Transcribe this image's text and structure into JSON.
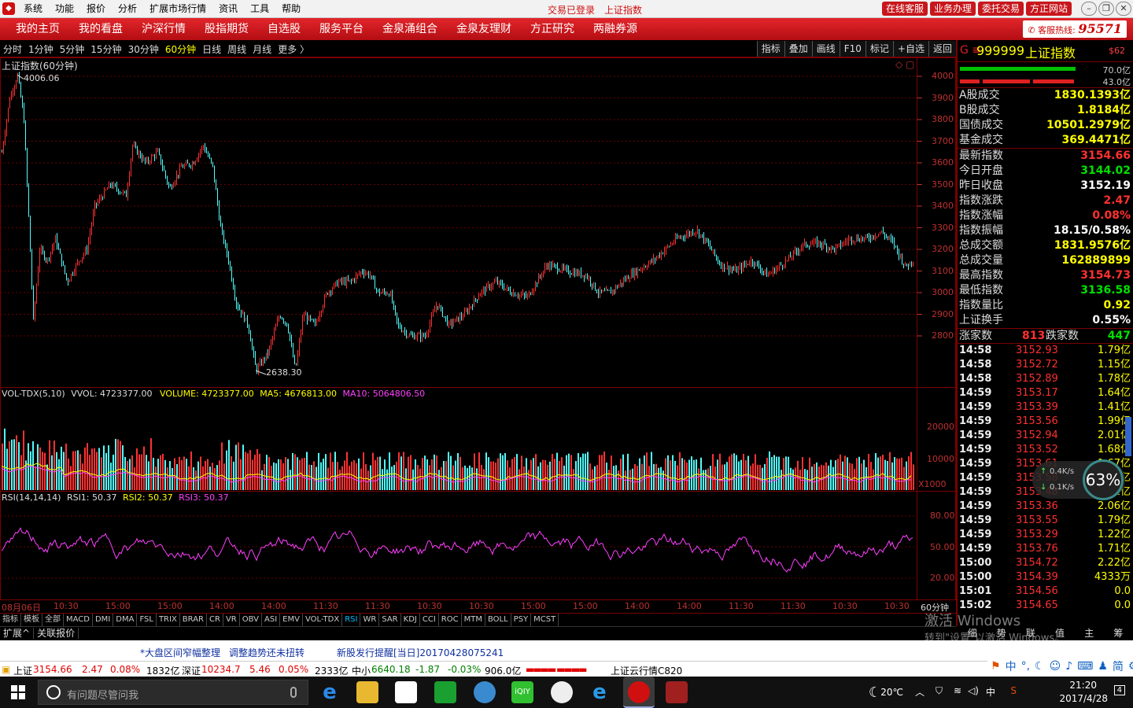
{
  "menubar": {
    "items": [
      "系统",
      "功能",
      "报价",
      "分析",
      "扩展市场行情",
      "资讯",
      "工具",
      "帮助"
    ],
    "trade_status": "交易已登录",
    "current_name": "上证指数",
    "buttons": [
      "在线客服",
      "业务办理",
      "委托交易",
      "方正网站"
    ]
  },
  "navbar": {
    "items": [
      "我的主页",
      "我的看盘",
      "沪深行情",
      "股指期货",
      "自选股",
      "服务平台",
      "金泉涌组合",
      "金泉友理财",
      "方正研究",
      "两融券源"
    ],
    "hotline_label": "客服热线:",
    "hotline_number": "95571"
  },
  "periodbar": {
    "periods": [
      "分时",
      "1分钟",
      "5分钟",
      "15分钟",
      "30分钟",
      "60分钟",
      "日线",
      "周线",
      "月线",
      "更多 〉"
    ],
    "active_index": 5,
    "tools": [
      "指标",
      "叠加",
      "画线",
      "F10",
      "标记",
      "+自选",
      "返回"
    ]
  },
  "main_chart": {
    "title": "上证指数(60分钟)",
    "high_label": "4006.06",
    "low_label": "2638.30",
    "y_ticks": [
      "4000",
      "3900",
      "3800",
      "3700",
      "3600",
      "3500",
      "3400",
      "3300",
      "3200",
      "3100",
      "3000",
      "2900",
      "2800"
    ]
  },
  "vol_chart": {
    "header_name": "VOL-TDX(5,10)",
    "vvol": "VVOL: 4723377.00",
    "volume": "VOLUME: 4723377.00",
    "ma5": "MA5: 4676813.00",
    "ma10": "MA10: 5064806.50",
    "y_ticks": [
      "20000",
      "10000"
    ],
    "unit": "X1000"
  },
  "rsi_chart": {
    "header_name": "RSI(14,14,14)",
    "rsi1": "RSI1: 50.37",
    "rsi2": "RSI2: 50.37",
    "rsi3": "RSI3: 50.37",
    "y_ticks": [
      "80.00",
      "50.00",
      "20.00"
    ]
  },
  "time_axis": {
    "labels": [
      "08月06日",
      "10:30",
      "15:00",
      "15:00",
      "14:00",
      "14:00",
      "11:30",
      "11:30",
      "10:30",
      "10:30",
      "15:00",
      "15:00",
      "14:00",
      "14:00",
      "11:30",
      "11:30",
      "10:30",
      "10:30"
    ],
    "period_label": "60分钟"
  },
  "indicator_tabs": [
    "指标",
    "模板",
    "全部",
    "MACD",
    "DMI",
    "DMA",
    "FSL",
    "TRIX",
    "BRAR",
    "CR",
    "VR",
    "OBV",
    "ASI",
    "EMV",
    "VOL-TDX",
    "RSI",
    "WR",
    "SAR",
    "KDJ",
    "CCI",
    "ROC",
    "MTM",
    "BOLL",
    "PSY",
    "MCST"
  ],
  "indicator_active": "RSI",
  "bottom_tabs": [
    "扩展^",
    "关联报价"
  ],
  "right_panel": {
    "marker": "G ≡",
    "code": "999999",
    "name": "上证指数",
    "tag": "$62",
    "bar_values": [
      "70.0亿",
      "43.0亿"
    ],
    "turnover": [
      {
        "label": "A股成交",
        "value": "1830.1393亿"
      },
      {
        "label": "B股成交",
        "value": "1.8184亿"
      },
      {
        "label": "国债成交",
        "value": "10501.2979亿"
      },
      {
        "label": "基金成交",
        "value": "369.4471亿"
      }
    ],
    "stats": [
      {
        "label": "最新指数",
        "value": "3154.66",
        "color": "#ff3030"
      },
      {
        "label": "今日开盘",
        "value": "3144.02",
        "color": "#00e000"
      },
      {
        "label": "昨日收盘",
        "value": "3152.19",
        "color": "#ffffff"
      },
      {
        "label": "指数涨跌",
        "value": "2.47",
        "color": "#ff3030"
      },
      {
        "label": "指数涨幅",
        "value": "0.08%",
        "color": "#ff3030"
      },
      {
        "label": "指数振幅",
        "value": "18.15/0.58%",
        "color": "#ffffff"
      },
      {
        "label": "总成交额",
        "value": "1831.9576亿",
        "color": "#ffff00"
      },
      {
        "label": "总成交量",
        "value": "162889899",
        "color": "#ffff00"
      },
      {
        "label": "最高指数",
        "value": "3154.73",
        "color": "#ff3030"
      },
      {
        "label": "最低指数",
        "value": "3136.58",
        "color": "#00e000"
      },
      {
        "label": "指数量比",
        "value": "0.92",
        "color": "#ffff00"
      },
      {
        "label": "上证换手",
        "value": "0.55%",
        "color": "#ffffff"
      }
    ],
    "up_label": "涨家数",
    "up_count": "813",
    "down_label": "跌家数",
    "down_count": "447",
    "ticks": [
      {
        "time": "14:58",
        "price": "3152.93",
        "vol": "1.79亿"
      },
      {
        "time": "14:58",
        "price": "3152.72",
        "vol": "1.15亿"
      },
      {
        "time": "14:58",
        "price": "3152.89",
        "vol": "1.78亿"
      },
      {
        "time": "14:59",
        "price": "3153.17",
        "vol": "1.64亿"
      },
      {
        "time": "14:59",
        "price": "3153.39",
        "vol": "1.41亿"
      },
      {
        "time": "14:59",
        "price": "3153.56",
        "vol": "1.99亿"
      },
      {
        "time": "14:59",
        "price": "3152.94",
        "vol": "2.01亿"
      },
      {
        "time": "14:59",
        "price": "3153.52",
        "vol": "1.68亿"
      },
      {
        "time": "14:59",
        "price": "3153.61",
        "vol": "1.67亿"
      },
      {
        "time": "14:59",
        "price": "3153.58",
        "vol": "2.11亿"
      },
      {
        "time": "14:59",
        "price": "3153.48",
        "vol": "1.22亿"
      },
      {
        "time": "14:59",
        "price": "3153.36",
        "vol": "2.06亿"
      },
      {
        "time": "14:59",
        "price": "3153.55",
        "vol": "1.79亿"
      },
      {
        "time": "14:59",
        "price": "3153.29",
        "vol": "1.22亿"
      },
      {
        "time": "14:59",
        "price": "3153.76",
        "vol": "1.71亿"
      },
      {
        "time": "15:00",
        "price": "3154.72",
        "vol": "2.22亿"
      },
      {
        "time": "15:00",
        "price": "3154.39",
        "vol": "4333万"
      },
      {
        "time": "15:01",
        "price": "3154.56",
        "vol": "0.0"
      },
      {
        "time": "15:02",
        "price": "3154.65",
        "vol": "0.0"
      }
    ],
    "bottom_tabs": [
      "细",
      "势",
      "联",
      "值",
      "主",
      "筹"
    ]
  },
  "net_widget": {
    "up": "0.4K/s",
    "down": "0.1K/s",
    "percent": "63%"
  },
  "watermark": {
    "line1": "激活 Windows",
    "line2": "转到\"设置\"以激活 Windows。"
  },
  "news": [
    "*大盘区间窄幅整理",
    "调整趋势还未扭转",
    "新股发行提醒[当日]20170428075241"
  ],
  "quote_bar": {
    "sh_name": "上证",
    "sh_price": "3154.66",
    "sh_chg": "2.47",
    "sh_pct": "0.08%",
    "sh_amt": "1832亿",
    "sz_name": "深证",
    "sz_price": "10234.7",
    "sz_chg": "5.46",
    "sz_pct": "0.05%",
    "sz_amt": "2333亿",
    "zx_name": "中小",
    "zx_price": "6640.18",
    "zx_chg": "-1.87",
    "zx_pct": "-0.03%",
    "zx_amt": "906.0亿",
    "cloud": "上证云行情C820"
  },
  "ime": [
    "中",
    "简"
  ],
  "taskbar": {
    "search_placeholder": "有问题尽管问我",
    "weather": "20℃",
    "ime": "中",
    "time": "21:20",
    "date": "2017/4/28",
    "notif": "4"
  }
}
